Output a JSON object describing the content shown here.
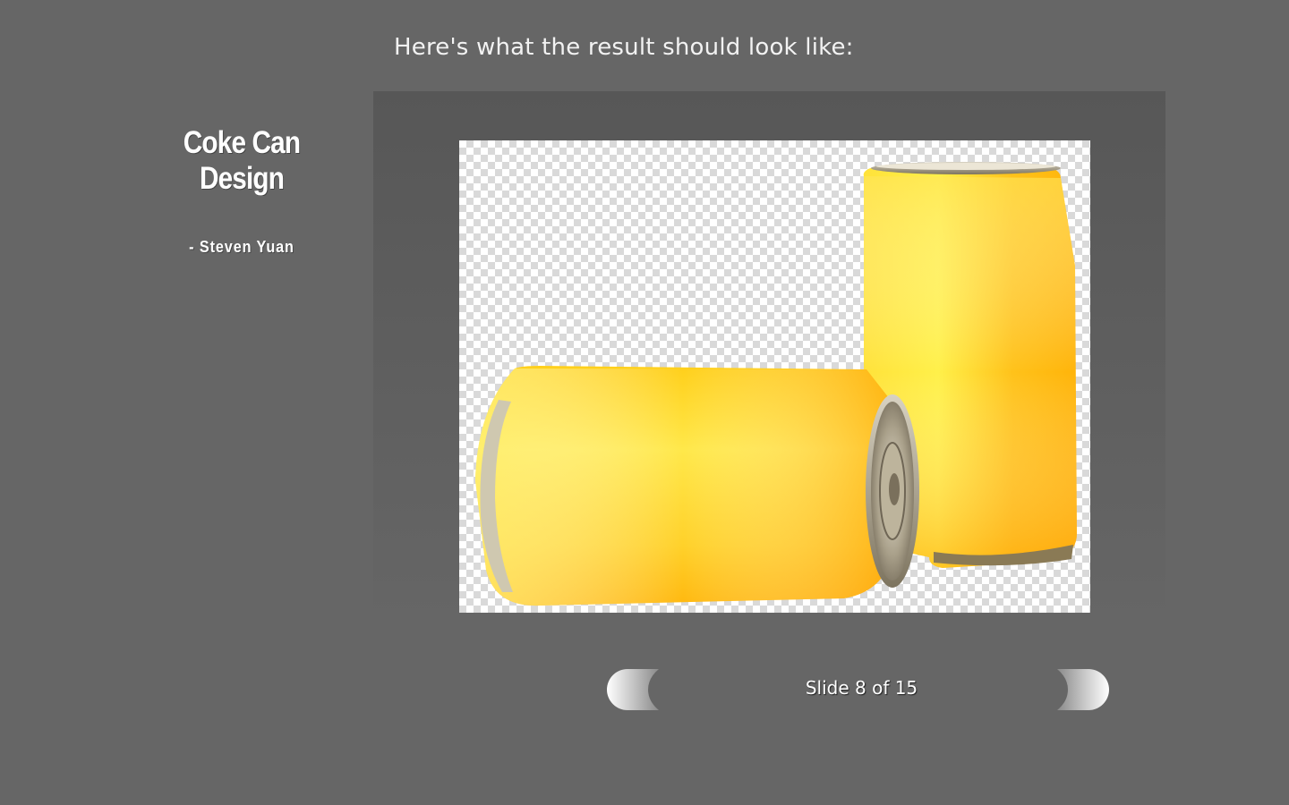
{
  "caption": "Here's what the result should look like:",
  "sidebar": {
    "title": "Coke Can Design",
    "author": "- Steven Yuan"
  },
  "image": {
    "icon": "yellow-soda-cans-image"
  },
  "navigation": {
    "slide_label": "Slide 8 of 15",
    "prev_icon": "previous-arrow-icon",
    "next_icon": "next-arrow-icon"
  },
  "colors": {
    "background": "#666666",
    "stage": "#575757",
    "can_yellow": "#ffd21a",
    "can_orange": "#ffb000"
  }
}
